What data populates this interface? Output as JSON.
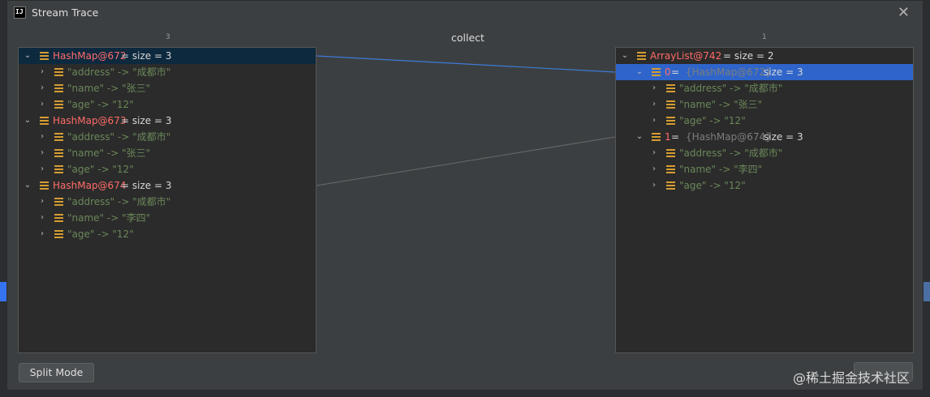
{
  "dialog": {
    "title": "Stream Trace",
    "close_glyph": "✕",
    "app_icon_text": "IJ"
  },
  "left_count": "3",
  "operation": "collect",
  "right_count": "1",
  "left_tree": {
    "nodes": [
      {
        "name": "HashMap@672",
        "rest": " =  size = 3",
        "expanded": true,
        "selected": true
      },
      {
        "key": "\"address\" -> \"成都市\""
      },
      {
        "key": "\"name\" -> \"张三\""
      },
      {
        "key": "\"age\" -> \"12\""
      },
      {
        "name": "HashMap@673",
        "rest": " =  size = 3",
        "expanded": true
      },
      {
        "key": "\"address\" -> \"成都市\""
      },
      {
        "key": "\"name\" -> \"张三\""
      },
      {
        "key": "\"age\" -> \"12\""
      },
      {
        "name": "HashMap@674",
        "rest": " =  size = 3",
        "expanded": true
      },
      {
        "key": "\"address\" -> \"成都市\""
      },
      {
        "key": "\"name\" -> \"李四\""
      },
      {
        "key": "\"age\" -> \"12\""
      }
    ]
  },
  "right_tree": {
    "root": {
      "name": "ArrayList@742",
      "rest": " =  size = 2"
    },
    "item0": {
      "index": "0",
      "eq": " = ",
      "ref": "{HashMap@672}",
      "size": "  size = 3"
    },
    "item0_children": [
      "\"address\" -> \"成都市\"",
      "\"name\" -> \"张三\"",
      "\"age\" -> \"12\""
    ],
    "item1": {
      "index": "1",
      "eq": " = ",
      "ref": "{HashMap@674}",
      "size": "  size = 3"
    },
    "item1_children": [
      "\"address\" -> \"成都市\"",
      "\"name\" -> \"李四\"",
      "\"age\" -> \"12\""
    ]
  },
  "buttons": {
    "split_mode": "Split Mode"
  },
  "watermark": "@稀土掘金技术社区",
  "colors": {
    "accent_blue": "#2f65ca",
    "selection_dark": "#0d293e",
    "connector": "#3d7bd8"
  }
}
